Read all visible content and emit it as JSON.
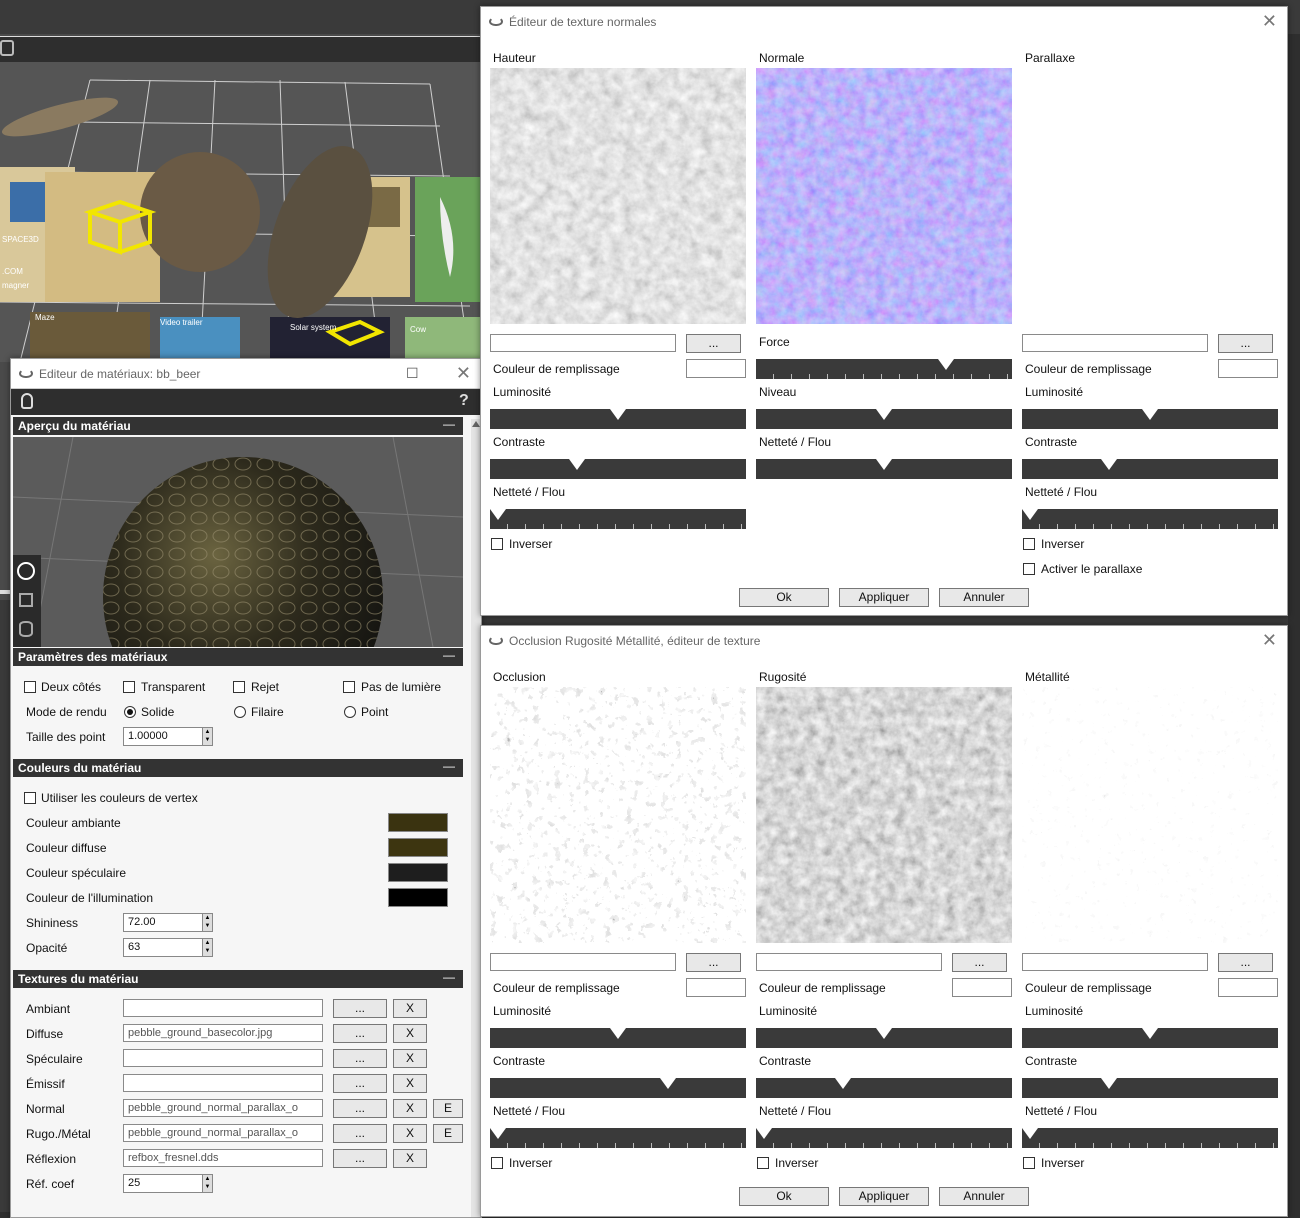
{
  "normal_editor": {
    "title": "Éditeur de texture normales",
    "col_hauteur": "Hauteur",
    "col_normale": "Normale",
    "col_parallaxe": "Parallaxe",
    "browse": "...",
    "fill_color": "Couleur de remplissage",
    "force": "Force",
    "luminosite": "Luminosité",
    "niveau": "Niveau",
    "contraste": "Contraste",
    "nettete": "Netteté / Flou",
    "inverser": "Inverser",
    "activer_parallaxe": "Activer le parallaxe",
    "ok": "Ok",
    "appliquer": "Appliquer",
    "annuler": "Annuler",
    "close": "✕",
    "sliders": {
      "force": 0.76,
      "lum_h": 0.5,
      "cont_h": 0.33,
      "net_h": 0.0,
      "niveau": 0.5,
      "net_n": 0.5,
      "lum_p": 0.5,
      "cont_p": 0.33,
      "net_p": 0.0
    }
  },
  "orm_editor": {
    "title": "Occlusion Rugosité Métallité, éditeur de texture",
    "col_occlusion": "Occlusion",
    "col_rugosite": "Rugosité",
    "col_metallite": "Métallité",
    "browse": "...",
    "fill_color": "Couleur de remplissage",
    "luminosite": "Luminosité",
    "contraste": "Contraste",
    "nettete": "Netteté / Flou",
    "inverser": "Inverser",
    "ok": "Ok",
    "appliquer": "Appliquer",
    "annuler": "Annuler",
    "close": "✕",
    "sliders": {
      "lum_o": 0.5,
      "cont_o": 0.71,
      "net_o": 0.0,
      "lum_r": 0.5,
      "cont_r": 0.33,
      "net_r": 0.0,
      "lum_m": 0.5,
      "cont_m": 0.33,
      "net_m": 0.0
    }
  },
  "material_editor": {
    "title": "Editeur de matériaux: bb_beer",
    "maximize": "☐",
    "close": "✕",
    "help": "?",
    "sec_preview": "Aperçu du matériau",
    "sec_params": "Paramètres des matériaux",
    "sec_colors": "Couleurs du matériau",
    "sec_textures": "Textures du matériau",
    "minus": "—",
    "deux_cotes": "Deux côtés",
    "transparent": "Transparent",
    "rejet": "Rejet",
    "pas_lumiere": "Pas de lumière",
    "mode_rendu": "Mode de rendu",
    "solide": "Solide",
    "filaire": "Filaire",
    "point": "Point",
    "taille_point": "Taille des point",
    "taille_point_value": "1.00000",
    "vertex_colors": "Utiliser les couleurs de vertex",
    "ambiante": "Couleur ambiante",
    "diffuse": "Couleur diffuse",
    "speculaire": "Couleur spéculaire",
    "illumination": "Couleur de l'illumination",
    "color_ambiante": "#3a3310",
    "color_diffuse": "#3d3510",
    "color_speculaire": "#1e1e1e",
    "color_illumination": "#000000",
    "shininess": "Shininess",
    "shininess_value": "72.00",
    "opacite": "Opacité",
    "opacite_value": "63",
    "tex_ambiant": "Ambiant",
    "tex_diffuse": "Diffuse",
    "tex_speculaire": "Spéculaire",
    "tex_emissif": "Émissif",
    "tex_normal": "Normal",
    "tex_rugo": "Rugo./Métal",
    "tex_reflexion": "Réflexion",
    "tex_refcoef": "Réf. coef",
    "val_diffuse": "pebble_ground_basecolor.jpg",
    "val_normal": "pebble_ground_normal_parallax_o",
    "val_rugo": "pebble_ground_normal_parallax_o",
    "val_reflexion": "refbox_fresnel.dds",
    "val_refcoef": "25",
    "browse": "...",
    "clear": "X",
    "edit": "E"
  },
  "viewport": {
    "labels": [
      "SPACE3D",
      ".COM",
      "magner",
      "Maze",
      "Video trailer",
      "Solar system",
      "Cow"
    ]
  }
}
